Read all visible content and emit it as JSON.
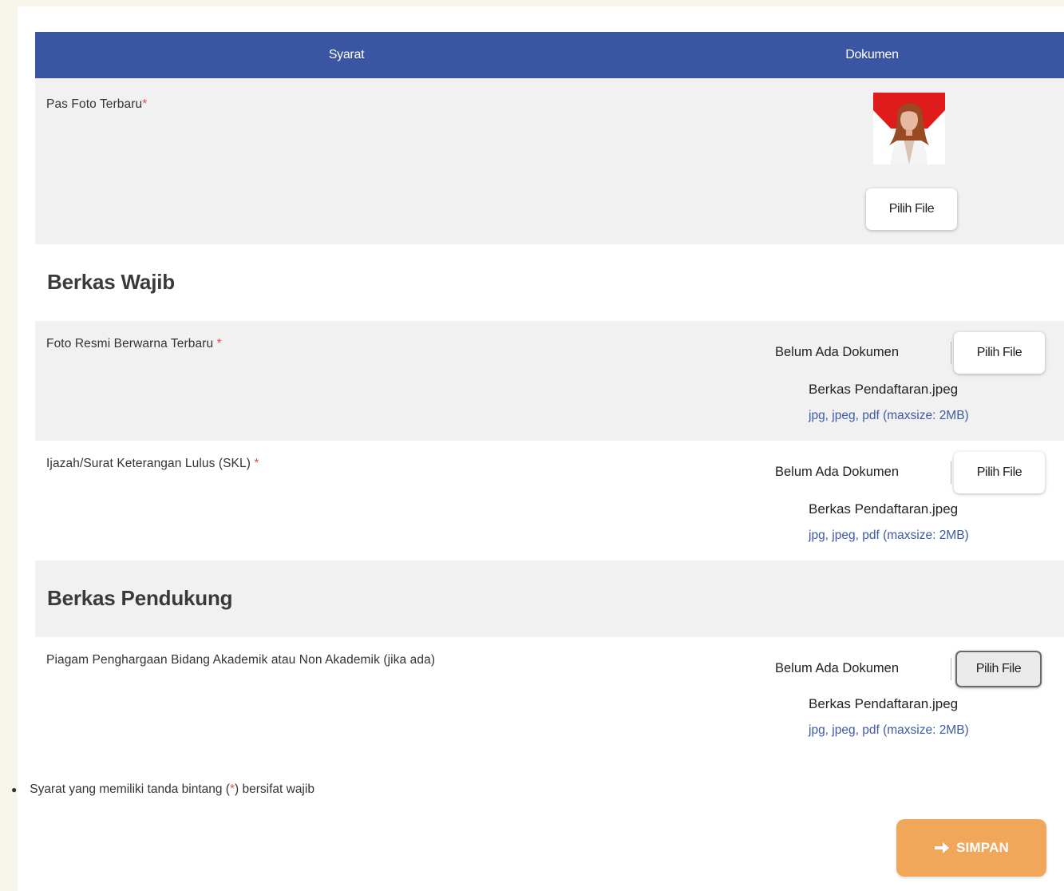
{
  "table": {
    "col_syarat": "Syarat",
    "col_dokumen": "Dokumen"
  },
  "pas_foto": {
    "label": "Pas Foto Terbaru",
    "star": "*",
    "button": "Pilih File"
  },
  "wajib": {
    "title": "Berkas Wajib",
    "items": [
      {
        "label": "Foto Resmi Berwarna Terbaru ",
        "star": "*",
        "status": "Belum Ada Dokumen",
        "button": "Pilih File",
        "filename": "Berkas Pendaftaran.jpeg",
        "hint": "jpg, jpeg, pdf (maxsize: 2MB)"
      },
      {
        "label": "Ijazah/Surat Keterangan Lulus (SKL) ",
        "star": "*",
        "status": "Belum Ada Dokumen",
        "button": "Pilih File",
        "filename": "Berkas Pendaftaran.jpeg",
        "hint": "jpg, jpeg, pdf (maxsize: 2MB)"
      }
    ]
  },
  "pendukung": {
    "title": "Berkas Pendukung",
    "items": [
      {
        "label": "Piagam Penghargaan Bidang Akademik atau Non Akademik (jika ada)",
        "status": "Belum Ada Dokumen",
        "button": "Pilih File",
        "filename": "Berkas Pendaftaran.jpeg",
        "hint": "jpg, jpeg, pdf (maxsize: 2MB)"
      }
    ]
  },
  "note": {
    "before": "Syarat yang memiliki tanda bintang (",
    "star": "*",
    "after": ") bersifat wajib"
  },
  "save": {
    "label": "SIMPAN",
    "icon": "arrow-right-icon"
  },
  "colors": {
    "header": "#3a56a3",
    "accent_orange": "#f0a75a",
    "required_star": "#d9534f",
    "hint_blue": "#3d5aa6"
  }
}
